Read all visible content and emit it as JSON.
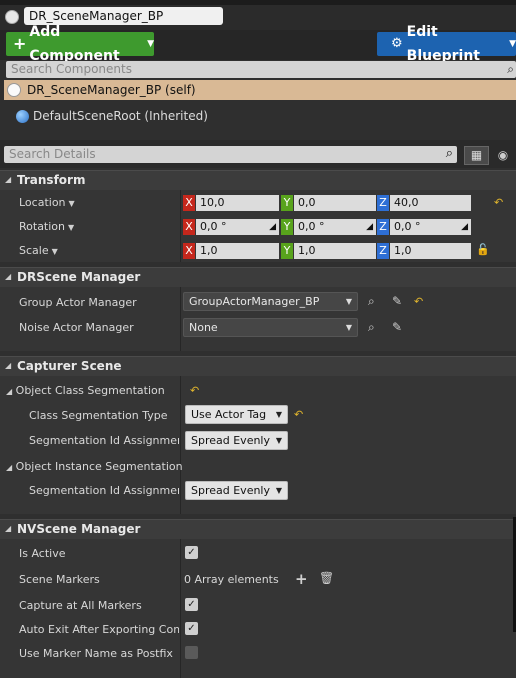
{
  "blueprint_name": "DR_SceneManager_BP",
  "toolbar": {
    "add_component": "Add Component",
    "edit_blueprint": "Edit Blueprint"
  },
  "components": {
    "search_placeholder": "Search Components",
    "self_item": "DR_SceneManager_BP (self)",
    "root_item": "DefaultSceneRoot (Inherited)"
  },
  "details": {
    "search_placeholder": "Search Details"
  },
  "transform": {
    "title": "Transform",
    "location": {
      "label": "Location",
      "x": "10,0",
      "y": "0,0",
      "z": "40,0"
    },
    "rotation": {
      "label": "Rotation",
      "x": "0,0 °",
      "y": "0,0 °",
      "z": "0,0 °"
    },
    "scale": {
      "label": "Scale",
      "x": "1,0",
      "y": "1,0",
      "z": "1,0"
    }
  },
  "drscene": {
    "title": "DRScene Manager",
    "group_label": "Group Actor Manager",
    "group_value": "GroupActorManager_BP",
    "noise_label": "Noise Actor Manager",
    "noise_value": "None"
  },
  "capturer": {
    "title": "Capturer Scene",
    "class_seg": "Object Class Segmentation",
    "class_seg_type_label": "Class Segmentation Type",
    "class_seg_type_value": "Use Actor Tag",
    "seg_id_label": "Segmentation Id Assignment Type",
    "seg_id_value": "Spread Evenly",
    "inst_seg": "Object Instance Segmentation",
    "inst_seg_id_label": "Segmentation Id Assignment Type",
    "inst_seg_id_value": "Spread Evenly"
  },
  "nvscene": {
    "title": "NVScene Manager",
    "is_active_label": "Is Active",
    "is_active": true,
    "markers_label": "Scene Markers",
    "markers_value": "0 Array elements",
    "capture_all_label": "Capture at All Markers",
    "capture_all": true,
    "auto_exit_label": "Auto Exit After Exporting Complete",
    "auto_exit": true,
    "marker_postfix_label": "Use Marker Name as Postfix",
    "marker_postfix": false
  },
  "axis_labels": {
    "x": "X",
    "y": "Y",
    "z": "Z"
  },
  "colors": {
    "add_button": "#3e9a2e",
    "edit_button": "#1d63b0",
    "self_highlight": "#d9b995",
    "axis_x": "#c5271c",
    "axis_y": "#58a31c",
    "axis_z": "#2e6fd5",
    "reset_arrow": "#e2b62d"
  }
}
